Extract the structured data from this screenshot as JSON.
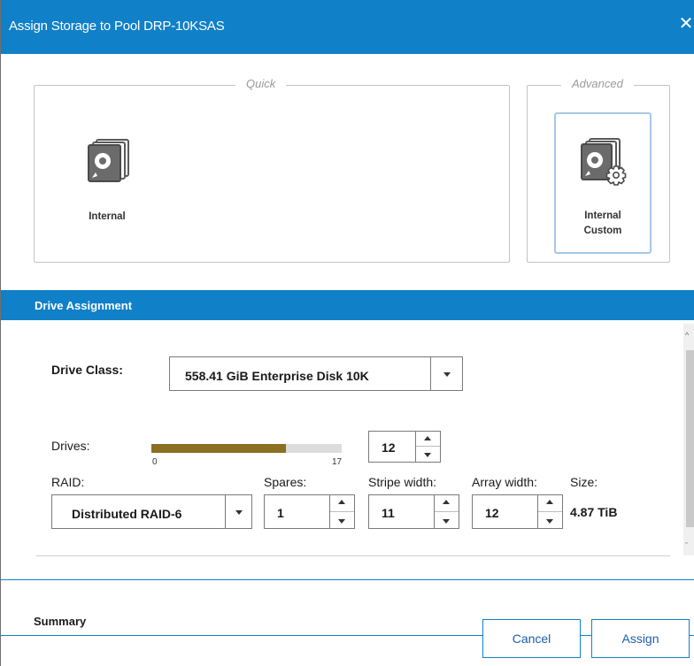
{
  "dialog": {
    "title": "Assign Storage to Pool DRP-10KSAS",
    "close_glyph": "✕"
  },
  "quick": {
    "legend": "Quick",
    "tiles": [
      {
        "label": "Internal",
        "icon": "disk-stack-icon"
      }
    ]
  },
  "advanced": {
    "legend": "Advanced",
    "tiles": [
      {
        "label_line1": "Internal",
        "label_line2": "Custom",
        "icon": "disk-stack-gear-icon",
        "selected": true
      }
    ]
  },
  "drive_assignment": {
    "header": "Drive Assignment",
    "drive_class": {
      "label": "Drive Class:",
      "value": "558.41 GiB Enterprise Disk 10K"
    },
    "drives": {
      "label": "Drives:",
      "min": "0",
      "max": "17",
      "value": "12",
      "fraction": 0.7059
    },
    "raid": {
      "label": "RAID:",
      "value": "Distributed RAID-6"
    },
    "spares": {
      "label": "Spares:",
      "value": "1"
    },
    "stripe_width": {
      "label": "Stripe width:",
      "value": "11"
    },
    "array_width": {
      "label": "Array width:",
      "value": "12"
    },
    "size": {
      "label": "Size:",
      "value": "4.87 TiB"
    }
  },
  "summary": {
    "label": "Summary"
  },
  "buttons": {
    "cancel": "Cancel",
    "assign": "Assign"
  },
  "colors": {
    "accent": "#1080c8",
    "slider_fill": "#8c7022",
    "selected_tile_border": "#a7c7e7"
  }
}
